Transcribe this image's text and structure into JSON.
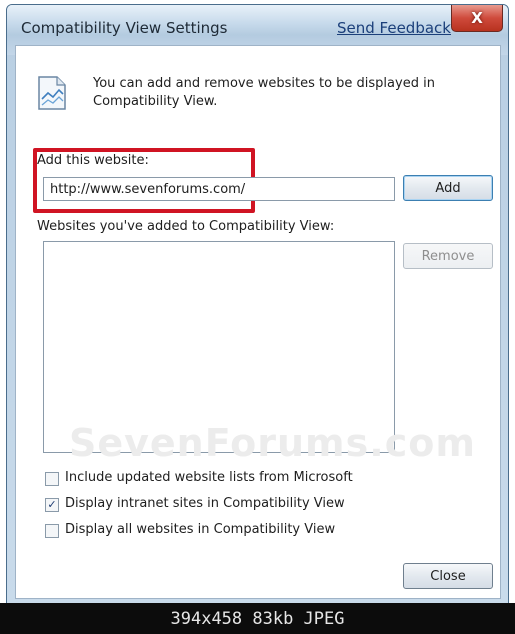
{
  "window": {
    "title": "Compatibility View Settings",
    "feedback_link": "Send Feedback",
    "close_glyph": "X"
  },
  "info": {
    "text": "You can add and remove websites to be displayed in Compatibility View.",
    "icon": "page-icon"
  },
  "add_section": {
    "label": "Add this website:",
    "input_value": "http://www.sevenforums.com/",
    "add_button": "Add",
    "highlight_color": "#d01423"
  },
  "list_section": {
    "label": "Websites you've added to Compatibility View:",
    "items": [],
    "remove_button": "Remove"
  },
  "watermark": "SevenForums.com",
  "options": [
    {
      "label": "Include updated website lists from Microsoft",
      "checked": false
    },
    {
      "label": "Display intranet sites in Compatibility View",
      "checked": true
    },
    {
      "label": "Display all websites in Compatibility View",
      "checked": false
    }
  ],
  "close_button": "Close",
  "image_info": "394x458  83kb  JPEG"
}
